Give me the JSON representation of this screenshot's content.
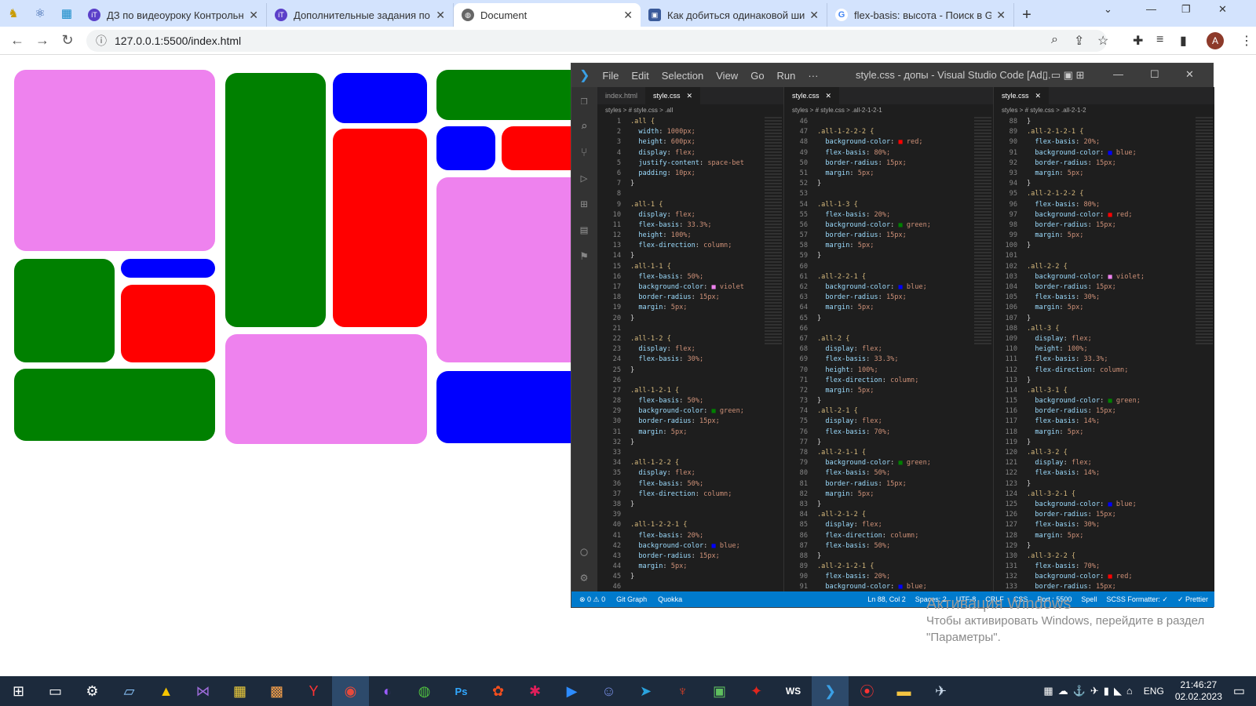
{
  "browser": {
    "tabs": [
      {
        "title": "ДЗ по видеоуроку Контрольное",
        "icon": "it-icon"
      },
      {
        "title": "Дополнительные задания по в",
        "icon": "it-icon"
      },
      {
        "title": "Document",
        "icon": "globe-icon",
        "active": true
      },
      {
        "title": "Как добиться одинаковой шир",
        "icon": "so-icon"
      },
      {
        "title": "flex-basis: высота - Поиск в Goo",
        "icon": "google-icon"
      }
    ],
    "url": "127.0.0.1:5500/index.html",
    "avatar_letter": "A"
  },
  "vscode": {
    "menu": [
      "File",
      "Edit",
      "Selection",
      "View",
      "Go",
      "Run",
      "···"
    ],
    "window_title": "style.css - допы - Visual Studio Code [Ad...",
    "panes": [
      {
        "tabs": [
          {
            "label": "index.html",
            "active": false
          },
          {
            "label": "style.css",
            "active": true
          }
        ],
        "breadcrumb": "styles > # style.css > .all",
        "lines": [
          {
            "n": "1",
            "t": ".all {"
          },
          {
            "n": "2",
            "t": "  width: 1000px;"
          },
          {
            "n": "3",
            "t": "  height: 600px;"
          },
          {
            "n": "4",
            "t": "  display: flex;"
          },
          {
            "n": "5",
            "t": "  justify-content: space-bet"
          },
          {
            "n": "6",
            "t": "  padding: 10px;"
          },
          {
            "n": "7",
            "t": "}"
          },
          {
            "n": "8",
            "t": ""
          },
          {
            "n": "9",
            "t": ".all-1 {"
          },
          {
            "n": "10",
            "t": "  display: flex;"
          },
          {
            "n": "11",
            "t": "  flex-basis: 33.3%;"
          },
          {
            "n": "12",
            "t": "  height: 100%;"
          },
          {
            "n": "13",
            "t": "  flex-direction: column;"
          },
          {
            "n": "14",
            "t": "}"
          },
          {
            "n": "15",
            "t": ".all-1-1 {"
          },
          {
            "n": "16",
            "t": "  flex-basis: 50%;"
          },
          {
            "n": "17",
            "t": "  background-color: ■violet"
          },
          {
            "n": "18",
            "t": "  border-radius: 15px;"
          },
          {
            "n": "19",
            "t": "  margin: 5px;"
          },
          {
            "n": "20",
            "t": "}"
          },
          {
            "n": "21",
            "t": ""
          },
          {
            "n": "22",
            "t": ".all-1-2 {"
          },
          {
            "n": "23",
            "t": "  display: flex;"
          },
          {
            "n": "24",
            "t": "  flex-basis: 30%;"
          },
          {
            "n": "25",
            "t": "}"
          },
          {
            "n": "26",
            "t": ""
          },
          {
            "n": "27",
            "t": ".all-1-2-1 {"
          },
          {
            "n": "28",
            "t": "  flex-basis: 50%;"
          },
          {
            "n": "29",
            "t": "  background-color: ■green;"
          },
          {
            "n": "30",
            "t": "  border-radius: 15px;"
          },
          {
            "n": "31",
            "t": "  margin: 5px;"
          },
          {
            "n": "32",
            "t": "}"
          },
          {
            "n": "33",
            "t": ""
          },
          {
            "n": "34",
            "t": ".all-1-2-2 {"
          },
          {
            "n": "35",
            "t": "  display: flex;"
          },
          {
            "n": "36",
            "t": "  flex-basis: 50%;"
          },
          {
            "n": "37",
            "t": "  flex-direction: column;"
          },
          {
            "n": "38",
            "t": "}"
          },
          {
            "n": "39",
            "t": ""
          },
          {
            "n": "40",
            "t": ".all-1-2-2-1 {"
          },
          {
            "n": "41",
            "t": "  flex-basis: 20%;"
          },
          {
            "n": "42",
            "t": "  background-color: ■blue;"
          },
          {
            "n": "43",
            "t": "  border-radius: 15px;"
          },
          {
            "n": "44",
            "t": "  margin: 5px;"
          },
          {
            "n": "45",
            "t": "}"
          },
          {
            "n": "46",
            "t": ""
          }
        ]
      },
      {
        "tabs": [
          {
            "label": "style.css",
            "active": true
          }
        ],
        "breadcrumb": "styles > # style.css > .all-2-1-2-1",
        "lines": [
          {
            "n": "46",
            "t": ""
          },
          {
            "n": "47",
            "t": ".all-1-2-2-2 {"
          },
          {
            "n": "48",
            "t": "  background-color: ■red;"
          },
          {
            "n": "49",
            "t": "  flex-basis: 80%;"
          },
          {
            "n": "50",
            "t": "  border-radius: 15px;"
          },
          {
            "n": "51",
            "t": "  margin: 5px;"
          },
          {
            "n": "52",
            "t": "}"
          },
          {
            "n": "53",
            "t": ""
          },
          {
            "n": "54",
            "t": ".all-1-3 {"
          },
          {
            "n": "55",
            "t": "  flex-basis: 20%;"
          },
          {
            "n": "56",
            "t": "  background-color: ■green;"
          },
          {
            "n": "57",
            "t": "  border-radius: 15px;"
          },
          {
            "n": "58",
            "t": "  margin: 5px;"
          },
          {
            "n": "59",
            "t": "}"
          },
          {
            "n": "60",
            "t": ""
          },
          {
            "n": "61",
            "t": ".all-2-2-1 {"
          },
          {
            "n": "62",
            "t": "  background-color: ■blue;"
          },
          {
            "n": "63",
            "t": "  border-radius: 15px;"
          },
          {
            "n": "64",
            "t": "  margin: 5px;"
          },
          {
            "n": "65",
            "t": "}"
          },
          {
            "n": "66",
            "t": ""
          },
          {
            "n": "67",
            "t": ".all-2 {"
          },
          {
            "n": "68",
            "t": "  display: flex;"
          },
          {
            "n": "69",
            "t": "  flex-basis: 33.3%;"
          },
          {
            "n": "70",
            "t": "  height: 100%;"
          },
          {
            "n": "71",
            "t": "  flex-direction: column;"
          },
          {
            "n": "72",
            "t": "  margin: 5px;"
          },
          {
            "n": "73",
            "t": "}"
          },
          {
            "n": "74",
            "t": ".all-2-1 {"
          },
          {
            "n": "75",
            "t": "  display: flex;"
          },
          {
            "n": "76",
            "t": "  flex-basis: 70%;"
          },
          {
            "n": "77",
            "t": "}"
          },
          {
            "n": "78",
            "t": ".all-2-1-1 {"
          },
          {
            "n": "79",
            "t": "  background-color: ■green;"
          },
          {
            "n": "80",
            "t": "  flex-basis: 50%;"
          },
          {
            "n": "81",
            "t": "  border-radius: 15px;"
          },
          {
            "n": "82",
            "t": "  margin: 5px;"
          },
          {
            "n": "83",
            "t": "}"
          },
          {
            "n": "84",
            "t": ".all-2-1-2 {"
          },
          {
            "n": "85",
            "t": "  display: flex;"
          },
          {
            "n": "86",
            "t": "  flex-direction: column;"
          },
          {
            "n": "87",
            "t": "  flex-basis: 50%;"
          },
          {
            "n": "88",
            "t": "}"
          },
          {
            "n": "89",
            "t": ".all-2-1-2-1 {"
          },
          {
            "n": "90",
            "t": "  flex-basis: 20%;"
          },
          {
            "n": "91",
            "t": "  background-color: ■blue;"
          }
        ]
      },
      {
        "tabs": [
          {
            "label": "style.css",
            "active": true
          }
        ],
        "breadcrumb": "styles > # style.css > .all-2-1-2",
        "lines": [
          {
            "n": "88",
            "t": "}"
          },
          {
            "n": "89",
            "t": ".all-2-1-2-1 {"
          },
          {
            "n": "90",
            "t": "  flex-basis: 20%;"
          },
          {
            "n": "91",
            "t": "  background-color: ■blue;"
          },
          {
            "n": "92",
            "t": "  border-radius: 15px;"
          },
          {
            "n": "93",
            "t": "  margin: 5px;"
          },
          {
            "n": "94",
            "t": "}"
          },
          {
            "n": "95",
            "t": ".all-2-1-2-2 {"
          },
          {
            "n": "96",
            "t": "  flex-basis: 80%;"
          },
          {
            "n": "97",
            "t": "  background-color: ■red;"
          },
          {
            "n": "98",
            "t": "  border-radius: 15px;"
          },
          {
            "n": "99",
            "t": "  margin: 5px;"
          },
          {
            "n": "100",
            "t": "}"
          },
          {
            "n": "101",
            "t": ""
          },
          {
            "n": "102",
            "t": ".all-2-2 {"
          },
          {
            "n": "103",
            "t": "  background-color: ■violet;"
          },
          {
            "n": "104",
            "t": "  border-radius: 15px;"
          },
          {
            "n": "105",
            "t": "  flex-basis: 30%;"
          },
          {
            "n": "106",
            "t": "  margin: 5px;"
          },
          {
            "n": "107",
            "t": "}"
          },
          {
            "n": "108",
            "t": ".all-3 {"
          },
          {
            "n": "109",
            "t": "  display: flex;"
          },
          {
            "n": "110",
            "t": "  height: 100%;"
          },
          {
            "n": "111",
            "t": "  flex-basis: 33.3%;"
          },
          {
            "n": "112",
            "t": "  flex-direction: column;"
          },
          {
            "n": "113",
            "t": "}"
          },
          {
            "n": "114",
            "t": ".all-3-1 {"
          },
          {
            "n": "115",
            "t": "  background-color: ■green;"
          },
          {
            "n": "116",
            "t": "  border-radius: 15px;"
          },
          {
            "n": "117",
            "t": "  flex-basis: 14%;"
          },
          {
            "n": "118",
            "t": "  margin: 5px;"
          },
          {
            "n": "119",
            "t": "}"
          },
          {
            "n": "120",
            "t": ".all-3-2 {"
          },
          {
            "n": "121",
            "t": "  display: flex;"
          },
          {
            "n": "122",
            "t": "  flex-basis: 14%;"
          },
          {
            "n": "123",
            "t": "}"
          },
          {
            "n": "124",
            "t": ".all-3-2-1 {"
          },
          {
            "n": "125",
            "t": "  background-color: ■blue;"
          },
          {
            "n": "126",
            "t": "  border-radius: 15px;"
          },
          {
            "n": "127",
            "t": "  flex-basis: 30%;"
          },
          {
            "n": "128",
            "t": "  margin: 5px;"
          },
          {
            "n": "129",
            "t": "}"
          },
          {
            "n": "130",
            "t": ".all-3-2-2 {"
          },
          {
            "n": "131",
            "t": "  flex-basis: 70%;"
          },
          {
            "n": "132",
            "t": "  background-color: ■red;"
          },
          {
            "n": "133",
            "t": "  border-radius: 15px;"
          }
        ]
      }
    ],
    "status": {
      "left": [
        "⊗ 0 ⚠ 0",
        "Git Graph",
        "Quokka"
      ],
      "right": [
        "Ln 88, Col 2",
        "Spaces: 2",
        "UTF-8",
        "CRLF",
        "CSS",
        "Port : 5500",
        "Spell",
        "SCSS Formatter: ✓",
        "✓ Prettier"
      ]
    }
  },
  "watermark": {
    "heading": "Активация Windows",
    "line1": "Чтобы активировать Windows, перейдите в раздел",
    "line2": "\"Параметры\"."
  },
  "taskbar": {
    "lang": "ENG",
    "time": "21:46:27",
    "date": "02.02.2023"
  },
  "colors": {
    "violet": "#ee82ee",
    "green": "#008000",
    "blue": "#0000ff",
    "red": "#ff0000",
    "vscode_status": "#007acc"
  }
}
